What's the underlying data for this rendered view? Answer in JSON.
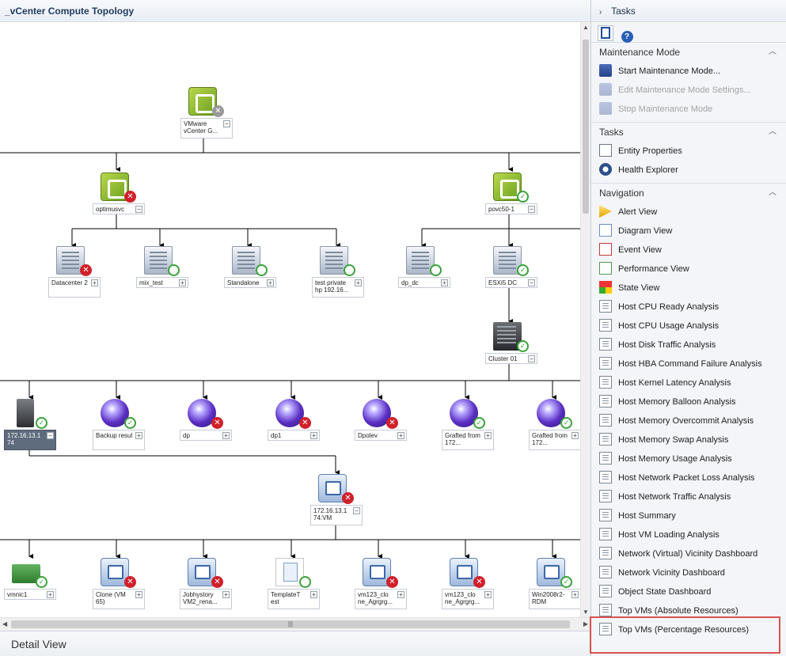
{
  "diagram": {
    "title": "_vCenter Compute Topology",
    "detail_view_label": "Detail View",
    "nodes": {
      "vcenter": {
        "label": "VMware vCenter G...",
        "status": "unknown"
      },
      "optimusvc": {
        "label": "optimusvc",
        "status": "error"
      },
      "povc50_1": {
        "label": "povc50-1",
        "status": "ok"
      },
      "datacenter2": {
        "label": "Datacenter 2",
        "status": "error"
      },
      "mix_test": {
        "label": "mix_test",
        "status": "ok"
      },
      "standalone": {
        "label": "Standalone",
        "status": "ok"
      },
      "test_private": {
        "label": "test private hp 192.16...",
        "status": "ok"
      },
      "dp_dc": {
        "label": "dp_dc",
        "status": "ok"
      },
      "esxi5_dc": {
        "label": "ESXi5 DC",
        "status": "ok"
      },
      "cluster01": {
        "label": "Cluster 01",
        "status": "ok"
      },
      "host_172": {
        "label": "172.16.13.1 74",
        "status": "ok"
      },
      "backup_resul": {
        "label": "Backup resul",
        "status": "ok"
      },
      "dp": {
        "label": "dp",
        "status": "error"
      },
      "dp1": {
        "label": "dp1",
        "status": "error"
      },
      "dpolev": {
        "label": "Dpolev",
        "status": "error"
      },
      "grafted_1": {
        "label": "Grafted from 172...",
        "status": "ok"
      },
      "grafted_2": {
        "label": "Grafted from 172...",
        "status": "ok"
      },
      "vm_group": {
        "label": "172.16.13.1 74:VM",
        "status": "error"
      },
      "vmnic1": {
        "label": "vmnic1",
        "status": "ok"
      },
      "clone_vm65": {
        "label": "Clone (VM 65)",
        "status": "error"
      },
      "jobhystory": {
        "label": "Jobhystory VM2_rena...",
        "status": "error"
      },
      "template_test": {
        "label": "TemplateT est",
        "status": "ok"
      },
      "vm123_clone_a": {
        "label": "vm123_clo ne_Agrgrg...",
        "status": "error"
      },
      "vm123_clone_b": {
        "label": "vm123_clo ne_Agrgrg...",
        "status": "error"
      },
      "win2008r2": {
        "label": "Win2008r2-RDM",
        "status": "ok"
      }
    }
  },
  "tasks": {
    "header": "Tasks",
    "sections": {
      "maintenance": {
        "title": "Maintenance Mode",
        "items": [
          "Start Maintenance Mode...",
          "Edit Maintenance Mode Settings...",
          "Stop Maintenance Mode"
        ]
      },
      "tasks": {
        "title": "Tasks",
        "items": [
          "Entity Properties",
          "Health Explorer"
        ]
      },
      "navigation": {
        "title": "Navigation",
        "items": [
          "Alert View",
          "Diagram View",
          "Event View",
          "Performance View",
          "State View",
          "Host CPU Ready Analysis",
          "Host CPU Usage Analysis",
          "Host Disk Traffic Analysis",
          "Host HBA Command Failure Analysis",
          "Host Kernel Latency Analysis",
          "Host Memory Balloon Analysis",
          "Host Memory Overcommit Analysis",
          "Host Memory Swap Analysis",
          "Host Memory Usage Analysis",
          "Host Network Packet Loss Analysis",
          "Host Network Traffic Analysis",
          "Host Summary",
          "Host VM Loading Analysis",
          "Network (Virtual) Vicinity Dashboard",
          "Network Vicinity Dashboard",
          "Object State Dashboard",
          "Top VMs (Absolute Resources)",
          "Top VMs (Percentage Resources)"
        ]
      }
    }
  },
  "colors": {
    "accent": "#1f3a5f",
    "error": "#d0202a",
    "ok": "#3aa33a",
    "highlight": "#d9534f"
  }
}
